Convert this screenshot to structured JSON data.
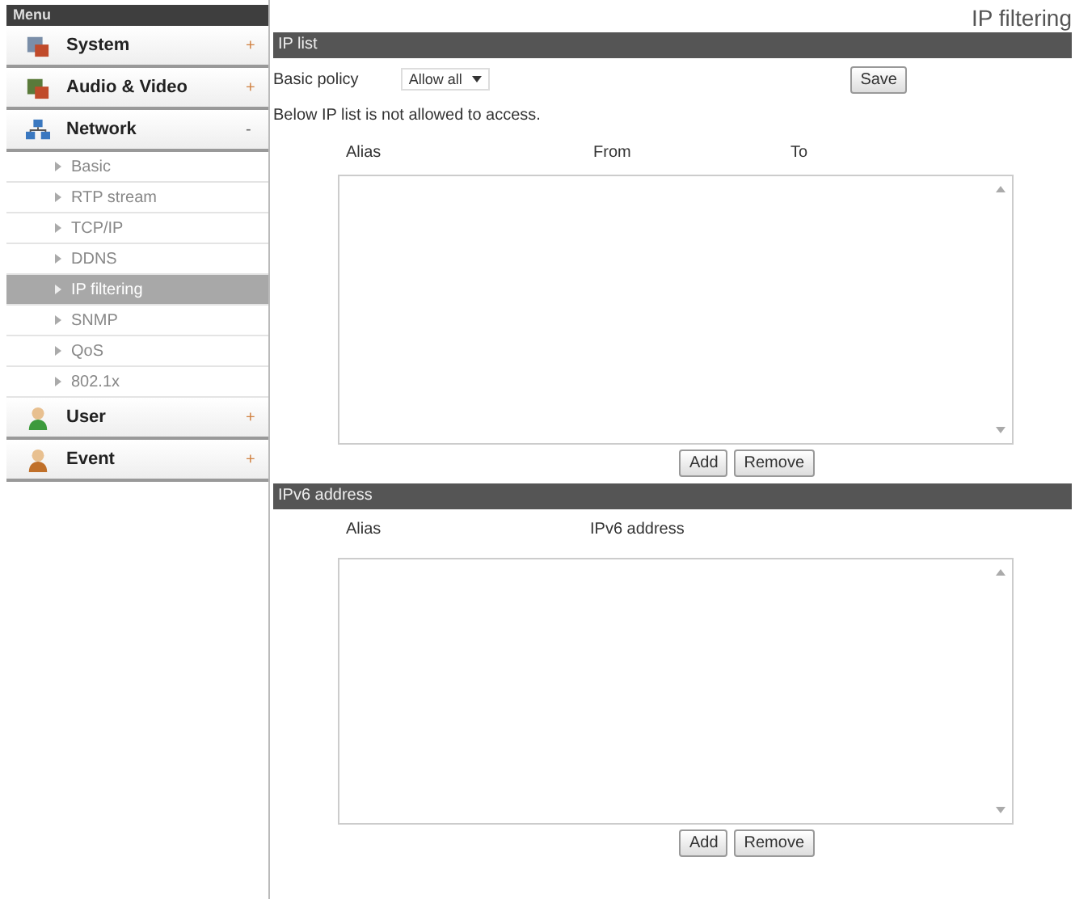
{
  "sidebar": {
    "header": "Menu",
    "groups": [
      {
        "label": "System",
        "sign": "+",
        "expanded": false
      },
      {
        "label": "Audio & Video",
        "sign": "+",
        "expanded": false
      },
      {
        "label": "Network",
        "sign": "-",
        "expanded": true,
        "children": [
          {
            "label": "Basic",
            "selected": false
          },
          {
            "label": "RTP stream",
            "selected": false
          },
          {
            "label": "TCP/IP",
            "selected": false
          },
          {
            "label": "DDNS",
            "selected": false
          },
          {
            "label": "IP filtering",
            "selected": true
          },
          {
            "label": "SNMP",
            "selected": false
          },
          {
            "label": "QoS",
            "selected": false
          },
          {
            "label": "802.1x",
            "selected": false
          }
        ]
      },
      {
        "label": "User",
        "sign": "+",
        "expanded": false
      },
      {
        "label": "Event",
        "sign": "+",
        "expanded": false
      }
    ]
  },
  "page_title": "IP filtering",
  "ip_list": {
    "header": "IP list",
    "policy_label": "Basic policy",
    "policy_value": "Allow all",
    "save": "Save",
    "note": "Below IP list is not allowed to access.",
    "columns": [
      "Alias",
      "From",
      "To"
    ],
    "buttons": [
      "Add",
      "Remove"
    ]
  },
  "ipv6": {
    "header": "IPv6 address",
    "columns": [
      "Alias",
      "IPv6 address"
    ],
    "buttons": [
      "Add",
      "Remove"
    ]
  }
}
